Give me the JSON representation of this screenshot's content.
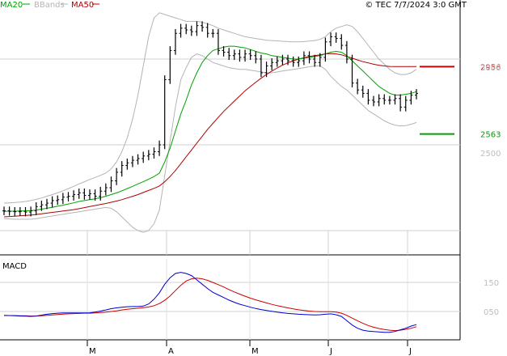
{
  "header": {
    "legend": [
      {
        "name": "MA20",
        "color": "#00a000"
      },
      {
        "name": "BBands",
        "color": "#b4b4b4"
      },
      {
        "name": "MA50",
        "color": "#b00000"
      }
    ],
    "copyright": "© TEC 7/7/2024 3:0 GMT"
  },
  "macd_panel": {
    "title": "MACD"
  },
  "chart_data": [
    {
      "type": "ohlc",
      "panel": "price",
      "x_months": [
        "M",
        "A",
        "M",
        "J",
        "J"
      ],
      "y_ticks": [
        "3000",
        "2500"
      ],
      "ylim": [
        2000,
        3250
      ],
      "grid": true,
      "markers": [
        {
          "label": "2956",
          "value": 2956,
          "color": "#cc0000"
        },
        {
          "label": "2563",
          "value": 2563,
          "color": "#00a000"
        }
      ],
      "series": [
        {
          "name": "Price",
          "color": "#000000",
          "values": [
            2115,
            2112,
            2110,
            2112,
            2108,
            2115,
            2140,
            2150,
            2160,
            2175,
            2180,
            2195,
            2200,
            2210,
            2220,
            2205,
            2215,
            2200,
            2230,
            2250,
            2290,
            2340,
            2380,
            2395,
            2410,
            2420,
            2435,
            2445,
            2460,
            2500,
            2880,
            3050,
            3150,
            3180,
            3170,
            3160,
            3195,
            3185,
            3150,
            3150,
            3050,
            3040,
            3020,
            3030,
            3010,
            3030,
            3020,
            3000,
            2920,
            2960,
            2980,
            2990,
            3000,
            2990,
            2980,
            2990,
            3020,
            3000,
            2980,
            3010,
            3100,
            3130,
            3120,
            3080,
            3000,
            2860,
            2820,
            2800,
            2760,
            2750,
            2770,
            2760,
            2760,
            2770,
            2720,
            2760,
            2790,
            2800
          ]
        },
        {
          "name": "MA20",
          "color": "#00a000",
          "values": [
            2112,
            2113,
            2113,
            2114,
            2115,
            2116,
            2120,
            2125,
            2130,
            2136,
            2142,
            2148,
            2155,
            2162,
            2170,
            2175,
            2180,
            2185,
            2192,
            2200,
            2210,
            2220,
            2232,
            2245,
            2258,
            2272,
            2285,
            2300,
            2315,
            2335,
            2400,
            2480,
            2580,
            2680,
            2760,
            2850,
            2920,
            2980,
            3020,
            3050,
            3060,
            3070,
            3075,
            3075,
            3070,
            3065,
            3055,
            3045,
            3035,
            3030,
            3020,
            3015,
            3010,
            3005,
            3000,
            3000,
            3005,
            3010,
            3015,
            3020,
            3030,
            3040,
            3045,
            3040,
            3020,
            2990,
            2960,
            2930,
            2900,
            2870,
            2840,
            2820,
            2800,
            2790,
            2790,
            2795,
            2800,
            2810
          ]
        },
        {
          "name": "MA50",
          "color": "#b00000",
          "values": [
            2080,
            2082,
            2084,
            2086,
            2088,
            2090,
            2094,
            2098,
            2102,
            2106,
            2110,
            2114,
            2118,
            2122,
            2128,
            2134,
            2140,
            2146,
            2152,
            2158,
            2165,
            2172,
            2180,
            2190,
            2200,
            2210,
            2222,
            2234,
            2246,
            2260,
            2285,
            2315,
            2350,
            2390,
            2430,
            2470,
            2510,
            2550,
            2590,
            2625,
            2660,
            2695,
            2725,
            2755,
            2785,
            2815,
            2840,
            2865,
            2888,
            2910,
            2930,
            2948,
            2965,
            2978,
            2990,
            3000,
            3008,
            3015,
            3020,
            3025,
            3030,
            3032,
            3030,
            3025,
            3015,
            3005,
            2995,
            2985,
            2978,
            2970,
            2964,
            2960,
            2957,
            2956,
            2956,
            2956,
            2956,
            2956
          ]
        },
        {
          "name": "BBands Upper",
          "color": "#b4b4b4",
          "values": [
            2160,
            2162,
            2164,
            2166,
            2170,
            2175,
            2182,
            2190,
            2200,
            2210,
            2220,
            2232,
            2245,
            2258,
            2272,
            2285,
            2298,
            2310,
            2322,
            2335,
            2360,
            2400,
            2460,
            2540,
            2650,
            2790,
            2960,
            3130,
            3240,
            3270,
            3260,
            3250,
            3240,
            3230,
            3220,
            3220,
            3220,
            3215,
            3205,
            3195,
            3180,
            3170,
            3160,
            3150,
            3140,
            3130,
            3125,
            3120,
            3115,
            3110,
            3108,
            3106,
            3104,
            3102,
            3100,
            3100,
            3102,
            3105,
            3108,
            3115,
            3130,
            3160,
            3180,
            3190,
            3200,
            3190,
            3160,
            3120,
            3080,
            3040,
            3000,
            2970,
            2940,
            2920,
            2910,
            2910,
            2920,
            2940
          ]
        },
        {
          "name": "BBands Lower",
          "color": "#b4b4b4",
          "values": [
            2070,
            2068,
            2066,
            2066,
            2066,
            2066,
            2070,
            2075,
            2080,
            2085,
            2090,
            2095,
            2100,
            2105,
            2110,
            2115,
            2120,
            2125,
            2130,
            2135,
            2130,
            2110,
            2080,
            2050,
            2020,
            2000,
            1990,
            2000,
            2040,
            2120,
            2320,
            2520,
            2720,
            2880,
            2950,
            3010,
            3030,
            3020,
            3000,
            2980,
            2970,
            2960,
            2950,
            2945,
            2940,
            2940,
            2935,
            2930,
            2925,
            2920,
            2920,
            2925,
            2930,
            2935,
            2940,
            2945,
            2950,
            2955,
            2960,
            2960,
            2940,
            2900,
            2870,
            2840,
            2820,
            2790,
            2760,
            2730,
            2700,
            2680,
            2660,
            2640,
            2625,
            2615,
            2610,
            2612,
            2620,
            2630
          ]
        }
      ]
    },
    {
      "type": "line",
      "panel": "macd",
      "y_ticks": [
        "150",
        "050"
      ],
      "series": [
        {
          "name": "MACD",
          "color": "#0000cc",
          "values": [
            5,
            4,
            3,
            2,
            1,
            0,
            2,
            6,
            10,
            13,
            15,
            16,
            16,
            16,
            16,
            16,
            17,
            20,
            25,
            30,
            36,
            40,
            43,
            45,
            46,
            46,
            48,
            58,
            80,
            110,
            150,
            180,
            200,
            205,
            200,
            190,
            170,
            150,
            130,
            112,
            100,
            88,
            76,
            66,
            57,
            50,
            43,
            37,
            32,
            28,
            24,
            20,
            17,
            14,
            12,
            10,
            9,
            8,
            7,
            8,
            10,
            12,
            8,
            0,
            -20,
            -40,
            -55,
            -64,
            -68,
            -70,
            -72,
            -74,
            -74,
            -70,
            -62,
            -55,
            -45,
            -38
          ]
        },
        {
          "name": "Signal",
          "color": "#cc0000",
          "values": [
            4,
            4,
            4,
            3,
            3,
            2,
            2,
            3,
            5,
            7,
            9,
            11,
            12,
            13,
            14,
            15,
            15,
            16,
            18,
            20,
            23,
            26,
            30,
            33,
            36,
            38,
            41,
            44,
            50,
            60,
            75,
            95,
            120,
            145,
            165,
            175,
            178,
            175,
            168,
            158,
            148,
            137,
            125,
            114,
            104,
            94,
            85,
            77,
            70,
            63,
            56,
            50,
            45,
            40,
            35,
            31,
            28,
            25,
            23,
            22,
            22,
            22,
            20,
            15,
            5,
            -8,
            -20,
            -32,
            -42,
            -50,
            -56,
            -61,
            -64,
            -66,
            -64,
            -60,
            -55,
            -48
          ]
        }
      ]
    }
  ]
}
